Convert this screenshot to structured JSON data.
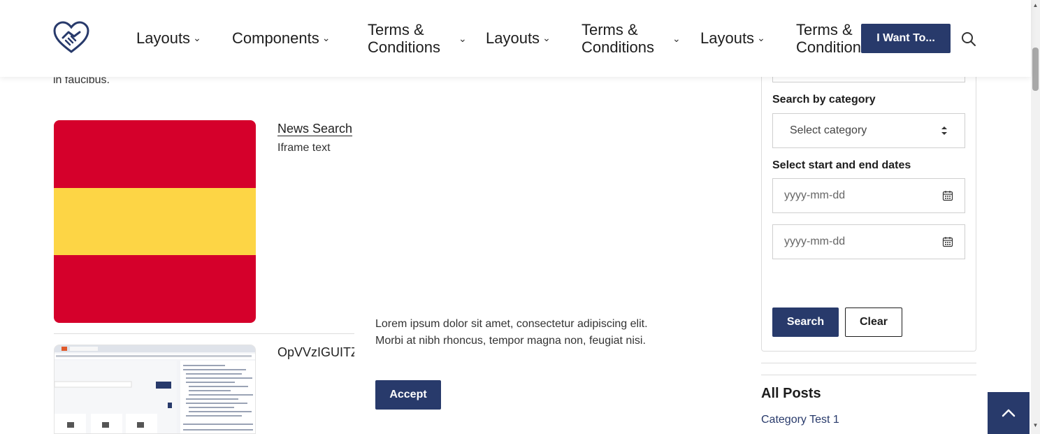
{
  "header": {
    "nav": [
      {
        "label": "Layouts"
      },
      {
        "label": "Components"
      },
      {
        "label": "Terms & Conditions"
      },
      {
        "label": "Layouts"
      },
      {
        "label": "Terms & Conditions"
      },
      {
        "label": "Layouts"
      },
      {
        "label": "Terms & Conditions"
      }
    ],
    "cta_label": "I Want To..."
  },
  "main": {
    "intro_fragment": "in faucibus.",
    "posts": [
      {
        "title": "News Search",
        "subtitle": "Iframe text"
      },
      {
        "title": "OpVVzIGUITZ"
      }
    ]
  },
  "cookie": {
    "text": "Lorem ipsum dolor sit amet, consectetur adipiscing elit. Morbi at nibh rhoncus, tempor magna non, feugiat nisi.",
    "accept_label": "Accept"
  },
  "sidebar": {
    "category_label": "Search by category",
    "category_placeholder": "Select category",
    "dates_label": "Select start and end dates",
    "start_placeholder": "yyyy-mm-dd",
    "end_placeholder": "yyyy-mm-dd",
    "search_label": "Search",
    "clear_label": "Clear",
    "all_posts_heading": "All Posts",
    "categories": [
      "Category Test 1"
    ]
  },
  "colors": {
    "primary": "#283a6b",
    "flag_red": "#d5002b",
    "flag_yellow": "#fdd545"
  }
}
